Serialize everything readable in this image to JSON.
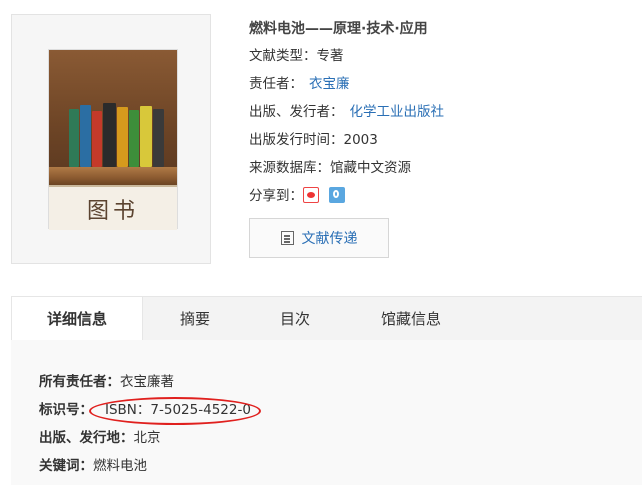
{
  "cover": {
    "label": "图书"
  },
  "book": {
    "title": "燃料电池——原理·技术·应用",
    "type_label": "文献类型：",
    "type_value": "专著",
    "author_label": "责任者：",
    "author_value": "衣宝廉",
    "publisher_label": "出版、发行者：",
    "publisher_value": "化学工业出版社",
    "year_label": "出版发行时间：",
    "year_value": "2003",
    "source_label": "来源数据库：",
    "source_value": "馆藏中文资源",
    "share_label": "分享到：",
    "share_icons": [
      "sina-weibo-icon",
      "tencent-weibo-icon"
    ]
  },
  "actions": {
    "deliver_label": "文献传递"
  },
  "tabs": [
    {
      "label": "详细信息",
      "active": true
    },
    {
      "label": "摘要",
      "active": false
    },
    {
      "label": "目次",
      "active": false
    },
    {
      "label": "馆藏信息",
      "active": false
    }
  ],
  "details": {
    "responsible_label": "所有责任者：",
    "responsible_value": "衣宝廉著",
    "identifier_label": "标识号：",
    "identifier_value": "ISBN：7-5025-4522-0",
    "place_label": "出版、发行地：",
    "place_value": "北京",
    "keywords_label": "关键词：",
    "keywords_value": "燃料电池"
  },
  "colors": {
    "link": "#2a6fb5",
    "highlight": "#e0201e"
  }
}
